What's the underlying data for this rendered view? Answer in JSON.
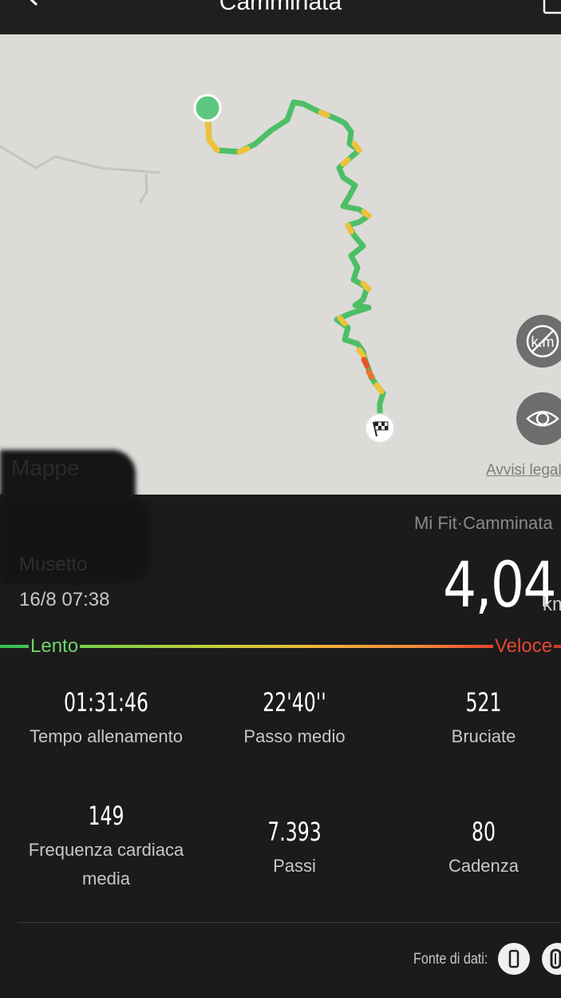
{
  "header": {
    "title": "Camminata"
  },
  "map": {
    "maps_logo": "Mappe",
    "legal_link": "Avvisi legali",
    "route_colors": {
      "fast": "#4cbf66",
      "medium": "#f0c13a",
      "slow": "#e8542e"
    },
    "start_marker_color": "#5ec77e"
  },
  "summary": {
    "source": "Mi Fit·Camminata",
    "username": "Musetto",
    "datetime": "16/8 07:38",
    "distance": "4,04",
    "distance_unit": "km"
  },
  "pace_scale": {
    "slow_label": "Lento",
    "fast_label": "Veloce"
  },
  "stats": [
    {
      "value": "01:31:46",
      "label": "Tempo allenamento"
    },
    {
      "value": "22'40''",
      "label": "Passo medio"
    },
    {
      "value": "521",
      "label": "Bruciate"
    },
    {
      "value": "149",
      "label": "Frequenza cardiaca media"
    },
    {
      "value": "7.393",
      "label": "Passi"
    },
    {
      "value": "80",
      "label": "Cadenza"
    }
  ],
  "footer": {
    "data_source_label": "Fonte di dati:"
  }
}
